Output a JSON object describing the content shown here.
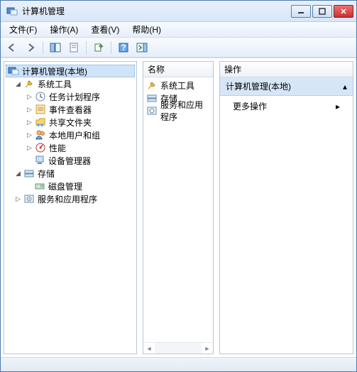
{
  "title": "计算机管理",
  "menus": {
    "file": "文件(F)",
    "action": "操作(A)",
    "view": "查看(V)",
    "help": "帮助(H)"
  },
  "tree": {
    "root": "计算机管理(本地)",
    "system_tools": "系统工具",
    "task_scheduler": "任务计划程序",
    "event_viewer": "事件查看器",
    "shared_folders": "共享文件夹",
    "local_users": "本地用户和组",
    "performance": "性能",
    "device_manager": "设备管理器",
    "storage": "存储",
    "disk_mgmt": "磁盘管理",
    "services_apps": "服务和应用程序"
  },
  "mid": {
    "header": "名称",
    "items": {
      "system_tools": "系统工具",
      "storage": "存储",
      "services_apps": "服务和应用程序"
    }
  },
  "right": {
    "header": "操作",
    "section": "计算机管理(本地)",
    "more_actions": "更多操作"
  }
}
